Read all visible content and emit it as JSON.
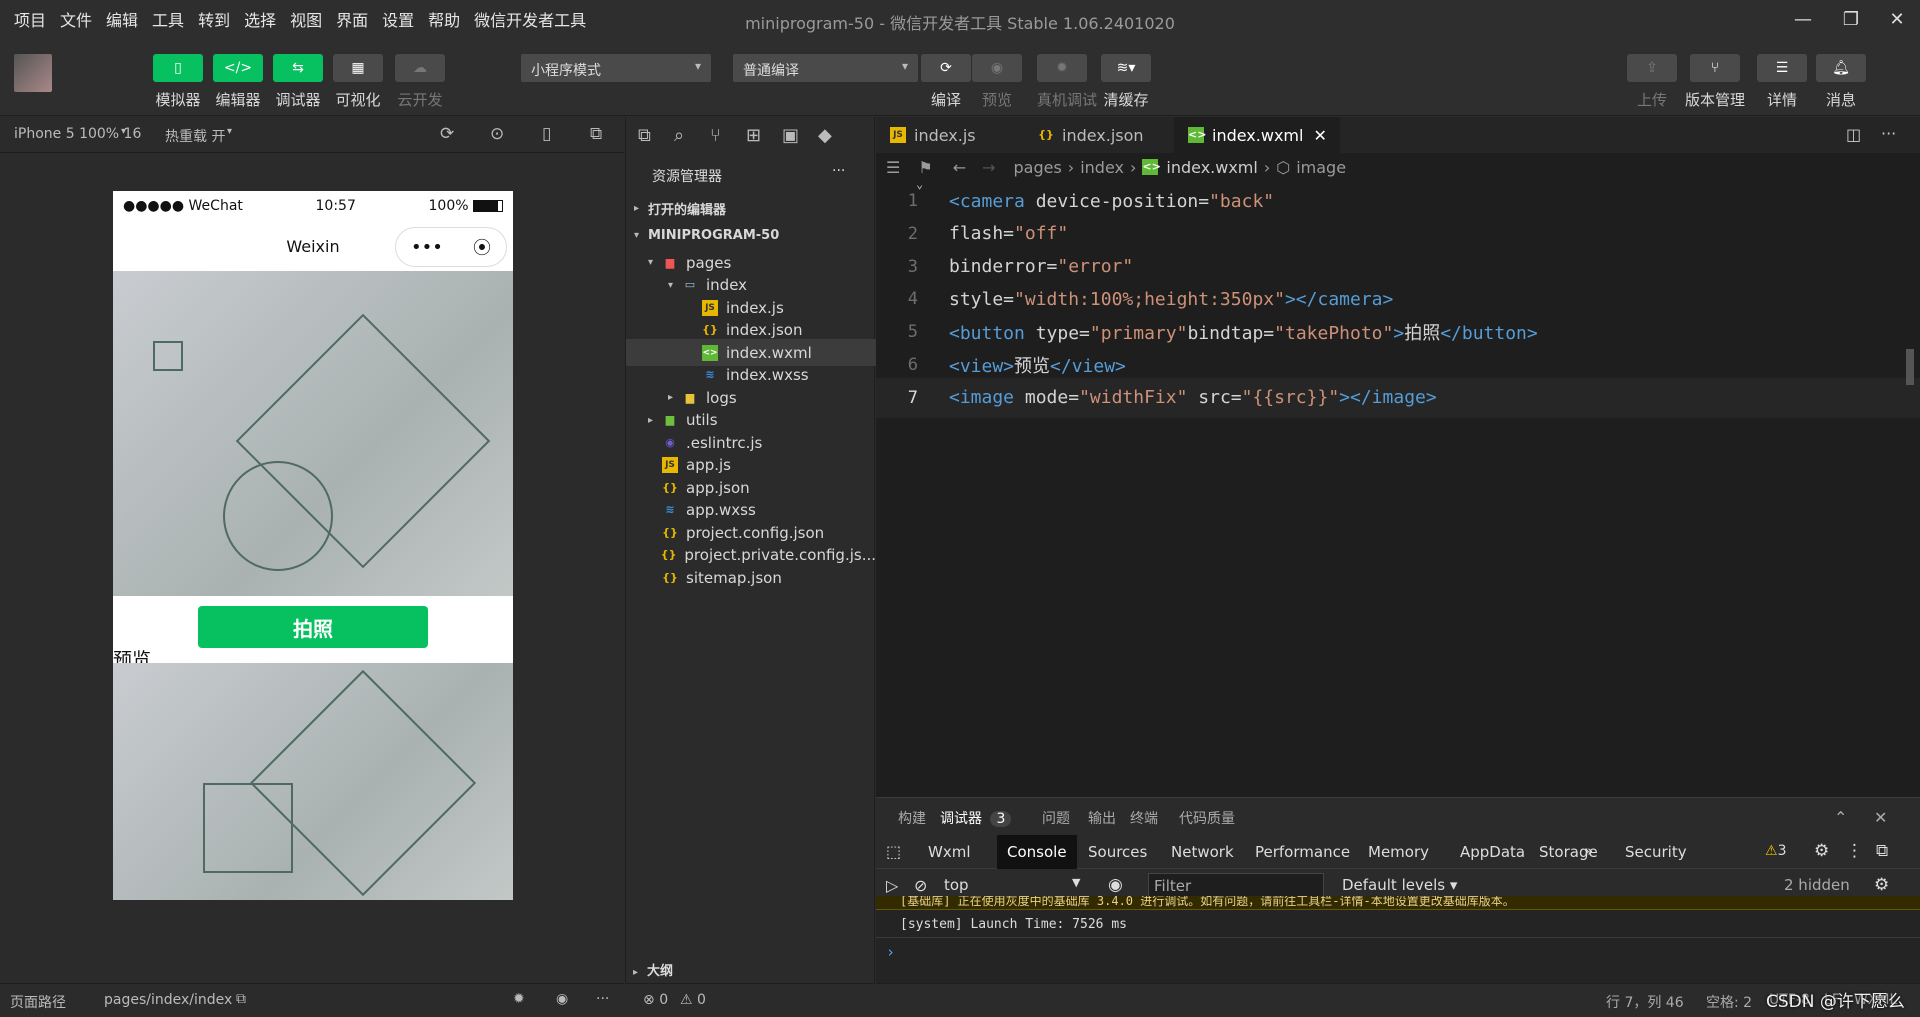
{
  "menubar": {
    "items": [
      "项目",
      "文件",
      "编辑",
      "工具",
      "转到",
      "选择",
      "视图",
      "界面",
      "设置",
      "帮助",
      "微信开发者工具"
    ],
    "title_project": "miniprogram-50",
    "title_sep": " - ",
    "title_app": "微信开发者工具 Stable 1.06.2401020"
  },
  "toolbar": {
    "simulator": "模拟器",
    "editor": "编辑器",
    "debugger": "调试器",
    "visual": "可视化",
    "cloud": "云开发",
    "mode_select": "小程序模式",
    "compile_select": "普通编译",
    "compile": "编译",
    "preview": "预览",
    "remote_debug": "真机调试",
    "clear_cache": "清缓存",
    "upload": "上传",
    "version": "版本管理",
    "details": "详情",
    "messages": "消息"
  },
  "simulator": {
    "device": "iPhone 5 100% 16",
    "hot_reload": "热重载 开",
    "status_carrier": "●●●●● WeChat",
    "status_time": "10:57",
    "status_battery": "100%",
    "nav_title": "Weixin",
    "capsule_more": "•••",
    "take_photo": "拍照",
    "preview_text": "预览",
    "page_path_label": "页面路径",
    "page_path": "pages/index/index"
  },
  "explorer": {
    "title": "资源管理器",
    "more": "···",
    "open_editors": "打开的编辑器",
    "project": "MINIPROGRAM-50",
    "tree": [
      {
        "name": "pages"
      },
      {
        "name": "index"
      },
      {
        "name": "index.js"
      },
      {
        "name": "index.json"
      },
      {
        "name": "index.wxml"
      },
      {
        "name": "index.wxss"
      },
      {
        "name": "logs"
      },
      {
        "name": "utils"
      },
      {
        "name": ".eslintrc.js"
      },
      {
        "name": "app.js"
      },
      {
        "name": "app.json"
      },
      {
        "name": "app.wxss"
      },
      {
        "name": "project.config.json"
      },
      {
        "name": "project.private.config.js..."
      },
      {
        "name": "sitemap.json"
      }
    ],
    "outline": "大纲",
    "errors": "0",
    "warnings": "0"
  },
  "editor": {
    "tabs": [
      "index.js",
      "index.json",
      "index.wxml"
    ],
    "breadcrumb": [
      "pages",
      "index",
      "index.wxml",
      "image"
    ],
    "lines": [
      {
        "n": "1",
        "tokens": [
          [
            "t",
            "<camera"
          ],
          [
            "a",
            " device-position="
          ],
          [
            "s",
            "\"back\""
          ]
        ]
      },
      {
        "n": "2",
        "tokens": [
          [
            "a",
            "flash="
          ],
          [
            "s",
            "\"off\""
          ]
        ]
      },
      {
        "n": "3",
        "tokens": [
          [
            "a",
            "binderror="
          ],
          [
            "s",
            "\"error\""
          ]
        ]
      },
      {
        "n": "4",
        "tokens": [
          [
            "a",
            "style="
          ],
          [
            "s",
            "\"width:100%;height:350px\""
          ],
          [
            "t",
            "></camera>"
          ]
        ]
      },
      {
        "n": "5",
        "tokens": [
          [
            "t",
            "<button"
          ],
          [
            "a",
            " type="
          ],
          [
            "s",
            "\"primary\""
          ],
          [
            "a",
            "bindtap="
          ],
          [
            "s",
            "\"takePhoto\""
          ],
          [
            "t",
            ">"
          ],
          [
            "p",
            "拍照"
          ],
          [
            "t",
            "</button>"
          ]
        ]
      },
      {
        "n": "6",
        "tokens": [
          [
            "t",
            "<view>"
          ],
          [
            "p",
            "预览"
          ],
          [
            "t",
            "</view>"
          ]
        ]
      },
      {
        "n": "7",
        "tokens": [
          [
            "t",
            "<image"
          ],
          [
            "a",
            " mode="
          ],
          [
            "s",
            "\"widthFix\""
          ],
          [
            "a",
            " src="
          ],
          [
            "s",
            "\"{{src}}\""
          ],
          [
            "t",
            "></image>"
          ]
        ]
      }
    ]
  },
  "devtools": {
    "panels": [
      "构建",
      "调试器",
      "问题",
      "输出",
      "终端",
      "代码质量"
    ],
    "debugger_badge": "3",
    "tabs": [
      "Wxml",
      "Console",
      "Sources",
      "Network",
      "Performance",
      "Memory",
      "AppData",
      "Storage",
      "Security"
    ],
    "more_tabs": "»",
    "warning_count": "3",
    "context": "top",
    "filter_placeholder": "Filter",
    "levels": "Default levels",
    "hidden": "2 hidden",
    "console_warn": "[基础库] 正在使用灰度中的基础库 3.4.0 进行调试。如有问题，请前往工具栏-详情-本地设置更改基础库版本。",
    "console_line": "[system] Launch Time: 7526 ms",
    "prompt": "›"
  },
  "statusbar": {
    "position": "行 7，列 46",
    "spaces": "空格: 2",
    "encoding": "UTF-8",
    "eol": "LF",
    "lang": "WXML",
    "watermark": "CSDN @许下愿么"
  }
}
